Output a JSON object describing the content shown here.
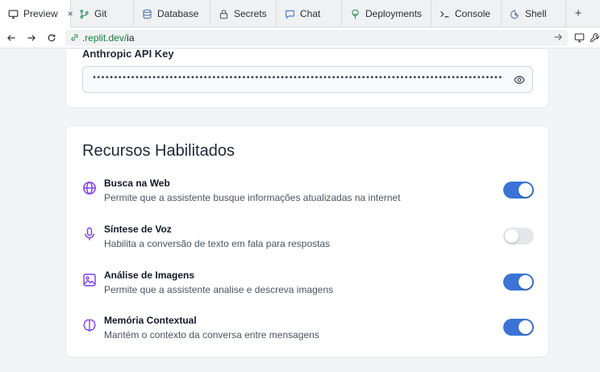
{
  "tabs": [
    {
      "label": "Preview",
      "icon": "monitor-icon",
      "active": true
    },
    {
      "label": "Git",
      "icon": "git-branch-icon"
    },
    {
      "label": "Database",
      "icon": "database-icon"
    },
    {
      "label": "Secrets",
      "icon": "lock-icon"
    },
    {
      "label": "Chat",
      "icon": "chat-bubble-icon"
    },
    {
      "label": "Deployments",
      "icon": "deployment-tree-icon"
    },
    {
      "label": "Console",
      "icon": "terminal-icon"
    },
    {
      "label": "Shell",
      "icon": "shell-icon"
    }
  ],
  "tab_close": "×",
  "tab_add": "+",
  "address": {
    "url": ".replit.dev/",
    "path": "ia"
  },
  "api_key": {
    "label": "Anthropic API Key",
    "value": "••••••••••••••••••••••••••••••••••••••••••••••••••••••••••••••••••••••••••••••••••••••••••••••••••••••••••••••••••••••••••••••"
  },
  "features": {
    "title": "Recursos Habilitados",
    "items": [
      {
        "name": "Busca na Web",
        "description": "Permite que a assistente busque informações atualizadas na internet",
        "icon": "globe-icon",
        "enabled": true
      },
      {
        "name": "Síntese de Voz",
        "description": "Habilita a conversão de texto em fala para respostas",
        "icon": "microphone-icon",
        "enabled": false
      },
      {
        "name": "Análise de Imagens",
        "description": "Permite que a assistente analise e descreva imagens",
        "icon": "image-icon",
        "enabled": true
      },
      {
        "name": "Memória Contextual",
        "description": "Mantém o contexto da conversa entre mensagens",
        "icon": "brain-icon",
        "enabled": true
      }
    ]
  },
  "colors": {
    "accent": "#3b74d6",
    "toggle_off": "#e5e7eb",
    "secure_link": "#1a7f3c"
  }
}
